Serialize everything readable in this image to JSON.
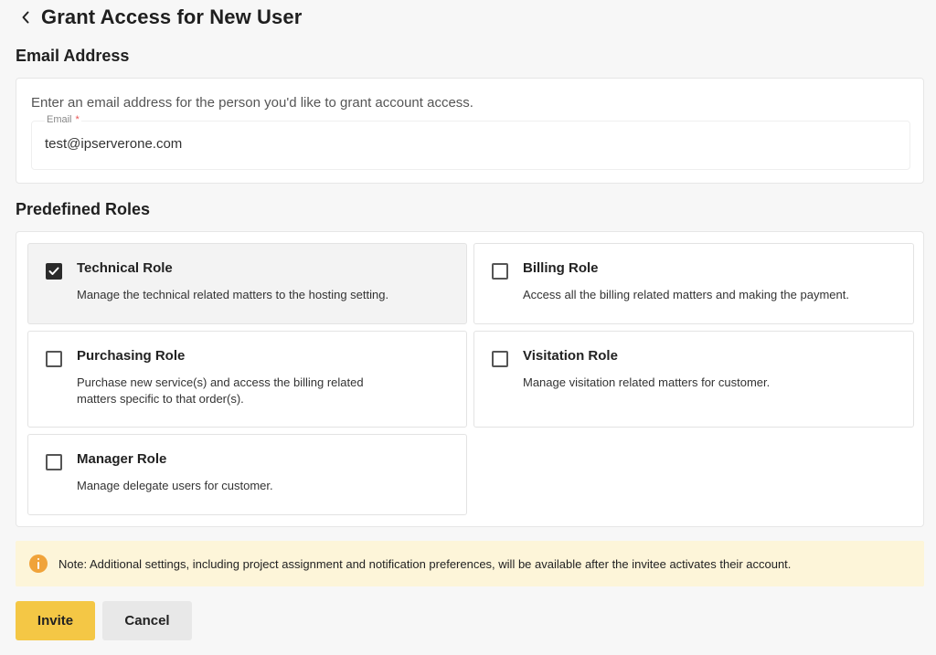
{
  "header": {
    "title": "Grant Access for New User"
  },
  "email_section": {
    "title": "Email Address",
    "description": "Enter an email address for the person you'd like to grant account access.",
    "field_label": "Email",
    "required_marker": "*",
    "value": "test@ipserverone.com"
  },
  "roles_section": {
    "title": "Predefined Roles",
    "roles": [
      {
        "name": "Technical Role",
        "description": "Manage the technical related matters to the hosting setting.",
        "checked": true
      },
      {
        "name": "Billing Role",
        "description": "Access all the billing related matters and making the payment.",
        "checked": false
      },
      {
        "name": "Purchasing Role",
        "description": "Purchase new service(s) and access the billing related matters specific to that order(s).",
        "checked": false
      },
      {
        "name": "Visitation Role",
        "description": "Manage visitation related matters for customer.",
        "checked": false
      },
      {
        "name": "Manager Role",
        "description": "Manage delegate users for customer.",
        "checked": false
      }
    ]
  },
  "note": {
    "icon": "info-icon",
    "text": "Note: Additional settings, including project assignment and notification preferences, will be available after the invitee activates their account."
  },
  "actions": {
    "invite_label": "Invite",
    "cancel_label": "Cancel"
  },
  "colors": {
    "accent": "#f4c745",
    "note_bg": "#fdf5d9",
    "info_icon": "#f0a33a"
  }
}
